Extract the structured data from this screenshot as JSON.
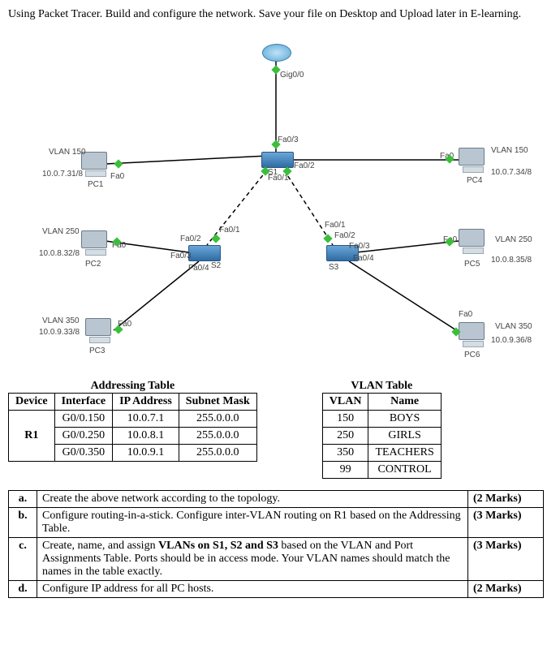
{
  "instructions": "Using Packet Tracer. Build and configure the network. Save your file on Desktop and Upload later in E-learning.",
  "devices": {
    "router": {
      "name": "R1"
    },
    "switches": [
      "S1",
      "S2",
      "S3"
    ],
    "pcs": [
      "PC1",
      "PC2",
      "PC3",
      "PC4",
      "PC5",
      "PC6"
    ]
  },
  "ports": {
    "gig00": "Gig0/0",
    "fa03": "Fa0/3",
    "fa02": "Fa0/2",
    "fa01": "Fa0/1",
    "fa04": "Fa0/4",
    "fa0": "Fa0"
  },
  "pc_info": {
    "pc1": {
      "vlan": "VLAN 150",
      "ip": "10.0.7.31/8",
      "name": "PC1"
    },
    "pc2": {
      "vlan": "VLAN 250",
      "ip": "10.0.8.32/8",
      "name": "PC2"
    },
    "pc3": {
      "vlan": "VLAN 350",
      "ip": "10.0.9.33/8",
      "name": "PC3"
    },
    "pc4": {
      "vlan": "VLAN 150",
      "ip": "10.0.7.34/8",
      "name": "PC4"
    },
    "pc5": {
      "vlan": "VLAN 250",
      "ip": "10.0.8.35/8",
      "name": "PC5"
    },
    "pc6": {
      "vlan": "VLAN 350",
      "ip": "10.0.9.36/8",
      "name": "PC6"
    }
  },
  "addressing_table": {
    "title": "Addressing Table",
    "headers": [
      "Device",
      "Interface",
      "IP Address",
      "Subnet Mask"
    ],
    "device": "R1",
    "rows": [
      {
        "iface": "G0/0.150",
        "ip": "10.0.7.1",
        "mask": "255.0.0.0"
      },
      {
        "iface": "G0/0.250",
        "ip": "10.0.8.1",
        "mask": "255.0.0.0"
      },
      {
        "iface": "G0/0.350",
        "ip": "10.0.9.1",
        "mask": "255.0.0.0"
      }
    ]
  },
  "vlan_table": {
    "title": "VLAN Table",
    "headers": [
      "VLAN",
      "Name"
    ],
    "rows": [
      {
        "id": "150",
        "name": "BOYS"
      },
      {
        "id": "250",
        "name": "GIRLS"
      },
      {
        "id": "350",
        "name": "TEACHERS"
      },
      {
        "id": "99",
        "name": "CONTROL"
      }
    ]
  },
  "tasks": [
    {
      "letter": "a.",
      "text": "Create the above network according to the topology.",
      "marks": "(2 Marks)"
    },
    {
      "letter": "b.",
      "text": "Configure routing-in-a-stick. Configure inter-VLAN routing on R1 based on the Addressing Table.",
      "marks": "(3 Marks)"
    },
    {
      "letter": "c.",
      "text": "Create, name, and assign VLANs on S1, S2 and S3 based on the VLAN and Port Assignments Table. Ports should be in access mode. Your VLAN names should match the names in the table exactly.",
      "marks": "(3 Marks)"
    },
    {
      "letter": "d.",
      "text": "Configure IP address for all PC hosts.",
      "marks": "(2 Marks)"
    }
  ],
  "bold_text": {
    "vlans_s": "VLANs on S1, S2 and S3"
  }
}
